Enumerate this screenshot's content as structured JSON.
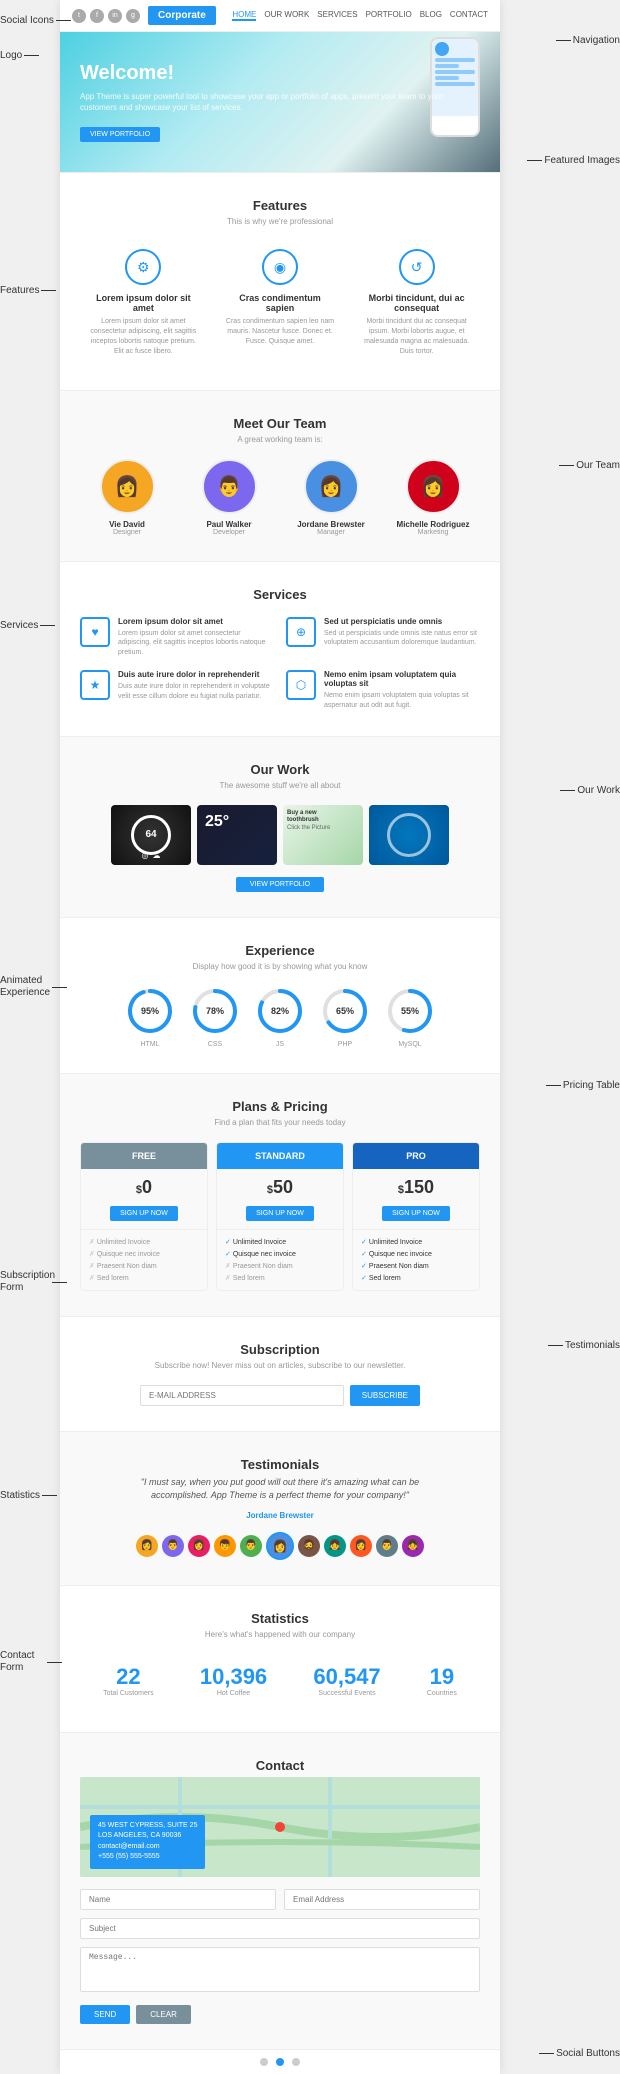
{
  "annotations": {
    "navigation": "Navigation",
    "social_icons": "Social Icons",
    "logo": "Logo",
    "featured_images": "Featured Images",
    "features": "Features",
    "our_team": "Our Team",
    "services": "Services",
    "our_work": "Our Work",
    "animated_experience": "Animated Experience",
    "pricing_table": "Pricing Table",
    "subscription_form": "Subscription Form",
    "testimonials": "Testimonials",
    "statistics": "Statistics",
    "contact_form": "Contact Form",
    "social_buttons": "Social Buttons"
  },
  "nav": {
    "logo": "Corporate",
    "links": [
      "HOME",
      "OUR WORK",
      "SERVICES",
      "PORTFOLIO",
      "BLOG",
      "CONTACT"
    ]
  },
  "social": {
    "icons": [
      "t",
      "f",
      "in",
      "g+"
    ]
  },
  "hero": {
    "title": "Welcome!",
    "subtitle": "App Theme is super powerful tool to showcase your app or portfolio of apps, present your team to your customers and showcase your list of services.",
    "btn": "VIEW PORTFOLIO"
  },
  "features": {
    "title": "Features",
    "subtitle": "This is why we're professional",
    "items": [
      {
        "icon": "⚙",
        "title": "Lorem ipsum dolor sit amet",
        "text": "Lorem ipsum dolor sit amet consectetur adipiscing, elit sagittis inceptos lobortis natoque pretium. Elit ac fusce libero."
      },
      {
        "icon": "◎",
        "title": "Cras condimentum sapien",
        "text": "Cras condimentum sapien leo nam mauris. Nascetur fusce. Donec et. Fusce. Quisque amet."
      },
      {
        "icon": "⟳",
        "title": "Morbi tincidunt, dui ac consequat",
        "text": "Morbi tincidunt dui ac consequat ipsum. Morbi lobortis augue, et malesuada magna ac malesuada. Duis tortor."
      }
    ]
  },
  "team": {
    "title": "Meet Our Team",
    "subtitle": "A great working team is:",
    "members": [
      {
        "name": "Vie David",
        "role": "Designer",
        "color": "#f5a623",
        "emoji": "👩"
      },
      {
        "name": "Paul Walker",
        "role": "Developer",
        "color": "#7b68ee",
        "emoji": "👨"
      },
      {
        "name": "Jordane Brewster",
        "role": "Manager",
        "color": "#4a90e2",
        "emoji": "👩"
      },
      {
        "name": "Michelle Rodriguez",
        "role": "Marketing",
        "color": "#d0021b",
        "emoji": "👩"
      }
    ]
  },
  "services": {
    "title": "Services",
    "subtitle": "",
    "items": [
      {
        "icon": "♥",
        "title": "Lorem ipsum dolor sit amet",
        "text": "Lorem ipsum dolor sit amet consectetur adipiscing, elit sagittis inceptos lobortis natoque pretium."
      },
      {
        "icon": "⊕",
        "title": "Sed ut perspiciatis unde omnis",
        "text": "Sed ut perspiciatis unde omnis iste natus error sit voluptatem accusantium doloremque laudantium."
      },
      {
        "icon": "☆",
        "title": "Duis aute irure dolor in reprehenderit",
        "text": "Duis aute irure dolor in reprehenderit in voluptate velit esse cillum dolore eu fugiat nulla pariatur."
      },
      {
        "icon": "⬡",
        "title": "Nemo enim ipsam voluptatem quia voluptas sit",
        "text": "Nemo enim ipsam voluptatem quia voluptas sit aspernatur aut odit aut fugit."
      }
    ]
  },
  "work": {
    "title": "Our Work",
    "subtitle": "The awesome stuff we're all about",
    "btn": "VIEW PORTFOLIO",
    "items": [
      {
        "type": "clock",
        "value": "64"
      },
      {
        "type": "temp",
        "value": "25°"
      },
      {
        "type": "toothbrush",
        "title": "Buy a new toothbrush",
        "subtitle": "Click the Picture"
      },
      {
        "type": "globe"
      }
    ]
  },
  "experience": {
    "title": "Experience",
    "subtitle": "Display how good it is by showing what you know",
    "items": [
      {
        "label": "HTML",
        "percent": 95
      },
      {
        "label": "CSS",
        "percent": 78
      },
      {
        "label": "JS",
        "percent": 82
      },
      {
        "label": "PHP",
        "percent": 65
      },
      {
        "label": "MySQL",
        "percent": 55
      }
    ]
  },
  "pricing": {
    "title": "Plans & Pricing",
    "subtitle": "Find a plan that fits your needs today",
    "plans": [
      {
        "name": "FREE",
        "price": "0",
        "btn": "SIGN UP NOW",
        "type": "free",
        "features": [
          {
            "text": "Unlimited Invoice",
            "included": false
          },
          {
            "text": "Quisque nec invoice",
            "included": false
          },
          {
            "text": "Praesent Non diam condiment",
            "included": false
          },
          {
            "text": "Sed lorem",
            "included": false
          }
        ]
      },
      {
        "name": "STANDARD",
        "price": "50",
        "btn": "SIGN UP NOW",
        "type": "standard",
        "features": [
          {
            "text": "Unlimited Invoice",
            "included": true
          },
          {
            "text": "Quisque nec invoice",
            "included": true
          },
          {
            "text": "Praesent Non diam condiment",
            "included": false
          },
          {
            "text": "Sed lorem",
            "included": false
          }
        ]
      },
      {
        "name": "PRO",
        "price": "150",
        "btn": "SIGN UP NOW",
        "type": "pro",
        "features": [
          {
            "text": "Unlimited Invoice",
            "included": true
          },
          {
            "text": "Quisque nec invoice",
            "included": true
          },
          {
            "text": "Praesent Non diam condiment",
            "included": true
          },
          {
            "text": "Sed lorem",
            "included": true
          }
        ]
      }
    ]
  },
  "subscription": {
    "title": "Subscription",
    "subtitle": "Subscribe now! Never miss out on articles, subscribe to our newsletter.",
    "placeholder": "E-MAIL ADDRESS",
    "btn": "SUBSCRIBE"
  },
  "testimonials": {
    "title": "Testimonials",
    "quote": "\"I must say, when you put good will out there it's amazing what can be accomplished. App Theme is a perfect theme for your company!\"",
    "author": "Jordane Brewster",
    "avatars": [
      "👩",
      "👨",
      "👩",
      "👦",
      "👨",
      "👩",
      "🧔",
      "👧",
      "👩",
      "👨",
      "👧"
    ]
  },
  "statistics": {
    "title": "Statistics",
    "subtitle": "Here's what's happened with our company",
    "items": [
      {
        "number": "22",
        "label": "Total Customers"
      },
      {
        "number": "10,396",
        "label": "Hot Coffee"
      },
      {
        "number": "60,547",
        "label": "Successful Events"
      },
      {
        "number": "19",
        "label": "Countries"
      }
    ]
  },
  "contact": {
    "title": "Contact",
    "address": "45 WEST CYPRESS, SUITE 25\nLOS ANGELES, CA 90036\ncontact@email.com\n+555 (55) 555-5555",
    "fields": {
      "name": "Name",
      "email": "Email Address",
      "subject": "Subject",
      "message": "Message..."
    },
    "send_btn": "SEND",
    "clear_btn": "CLEAR"
  },
  "footer": {
    "dots": [
      false,
      true,
      false
    ]
  }
}
